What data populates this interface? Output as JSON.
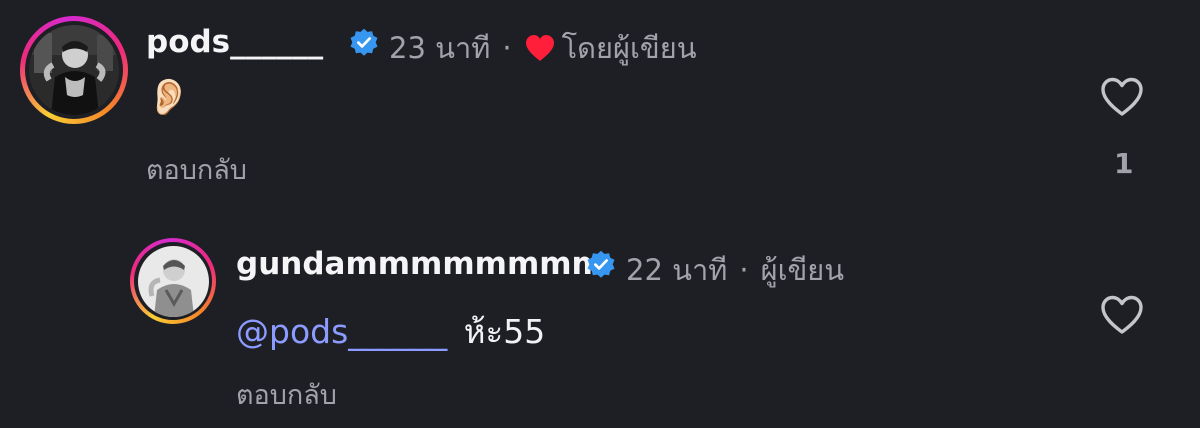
{
  "comments": [
    {
      "username": "pods______",
      "time": "23 นาที",
      "separator": "·",
      "liked_by_author_label": "โดยผู้เขียน",
      "body_emoji": "👂🏻",
      "reply_label": "ตอบกลับ",
      "like_count": "1"
    },
    {
      "username": "gundammmmmmmm",
      "time": "22 นาที",
      "separator": "·",
      "author_label": "ผู้เขียน",
      "mention": "@pods______",
      "body_text": "ห้ะ55",
      "reply_label": "ตอบกลับ"
    }
  ],
  "colors": {
    "background": "#1e1f24",
    "verified": "#3797f0",
    "mention": "#8c9bff",
    "heart": "#ff1f3a",
    "muted": "#a2a3aa"
  },
  "icons": [
    "verified-badge-icon",
    "heart-filled-icon",
    "heart-outline-icon"
  ]
}
